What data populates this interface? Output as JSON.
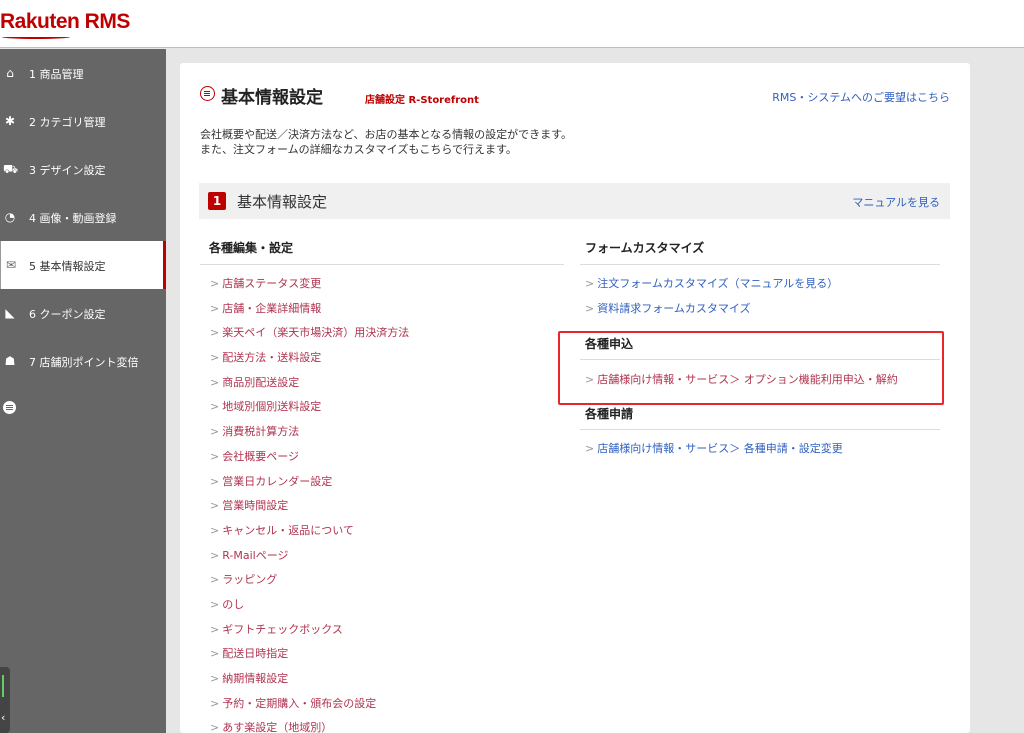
{
  "app": {
    "logo": "Rakuten RMS"
  },
  "sidebar": {
    "items": [
      {
        "label": "1 商品管理",
        "icon": "home-icon"
      },
      {
        "label": "2 カテゴリ管理",
        "icon": "gear-icon"
      },
      {
        "label": "3 デザイン設定",
        "icon": "cart-icon"
      },
      {
        "label": "4 画像・動画登録",
        "icon": "pie-chart-icon"
      },
      {
        "label": "5 基本情報設定",
        "icon": "chat-icon",
        "active": true
      },
      {
        "label": "6 クーポン設定",
        "icon": "megaphone-icon"
      },
      {
        "label": "7 店舗別ポイント変倍",
        "icon": "users-icon"
      }
    ],
    "icons": {
      "home": "⌂",
      "gear": "✱",
      "cart": "⛟",
      "pie": "◔",
      "chat": "✉",
      "coupon": "◣",
      "users": "☗"
    },
    "collapse_label": "‹"
  },
  "page": {
    "title": "基本情報設定",
    "subtitle": "店舗設定 R-Storefront",
    "request_link": "RMS・システムへのご要望はこちら",
    "description_line1": "会社概要や配送／決済方法など、お店の基本となる情報の設定ができます。",
    "description_line2": "また、注文フォームの詳細なカスタマイズもこちらで行えます。"
  },
  "section": {
    "number": "1",
    "title": "基本情報設定",
    "manual_link": "マニュアルを見る"
  },
  "left_column": {
    "heading": "各種編集・設定",
    "links": [
      "店舗ステータス変更",
      "店舗・企業詳細情報",
      "楽天ペイ（楽天市場決済）用決済方法",
      "配送方法・送料設定",
      "商品別配送設定",
      "地域別個別送料設定",
      "消費税計算方法",
      "会社概要ページ",
      "営業日カレンダー設定",
      "営業時間設定",
      "キャンセル・返品について",
      "R-Mailページ",
      "ラッピング",
      "のし",
      "ギフトチェックボックス",
      "配送日時指定",
      "納期情報設定",
      "予約・定期購入・頒布会の設定",
      "あす楽設定（地域別）"
    ]
  },
  "right_column": {
    "form_heading": "フォームカスタマイズ",
    "form_links": [
      "注文フォームカスタマイズ（マニュアルを見る）",
      "資料請求フォームカスタマイズ"
    ],
    "apply_heading": "各種申込",
    "apply_links": [
      "店舗様向け情報・サービス＞ オプション機能利用申込・解約"
    ],
    "request_heading": "各種申請",
    "request_links": [
      "店舗様向け情報・サービス＞ 各種申請・設定変更"
    ]
  },
  "colors": {
    "brand": "#bf0000",
    "link_red": "#b0334f",
    "link_blue": "#3060c0",
    "highlight": "#e8262b",
    "sidebar_bg": "#666666"
  }
}
